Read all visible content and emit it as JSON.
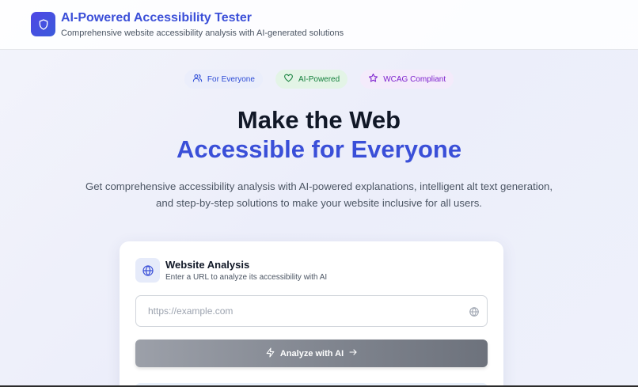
{
  "header": {
    "title": "AI-Powered Accessibility Tester",
    "subtitle": "Comprehensive website accessibility analysis with AI-generated solutions",
    "logo_icon": "shield-icon"
  },
  "badges": [
    {
      "label": "For Everyone",
      "icon": "users-icon",
      "color": "#2c4bd6"
    },
    {
      "label": "AI-Powered",
      "icon": "heart-icon",
      "color": "#15803d"
    },
    {
      "label": "WCAG Compliant",
      "icon": "star-icon",
      "color": "#7e22ce"
    }
  ],
  "hero": {
    "line1": "Make the Web",
    "line2": "Accessible for Everyone",
    "description_line1": "Get comprehensive accessibility analysis with AI-powered explanations, intelligent alt text generation,",
    "description_line2": "and step-by-step solutions to make your website inclusive for all users."
  },
  "analysis_card": {
    "title": "Website Analysis",
    "subtitle": "Enter a URL to analyze its accessibility with AI",
    "icon": "globe-icon",
    "url_input": {
      "value": "",
      "placeholder": "https://example.com"
    },
    "analyze_button": "Analyze with AI"
  },
  "colors": {
    "accent": "#3a4fd8",
    "button_gray": "#7e838d"
  }
}
